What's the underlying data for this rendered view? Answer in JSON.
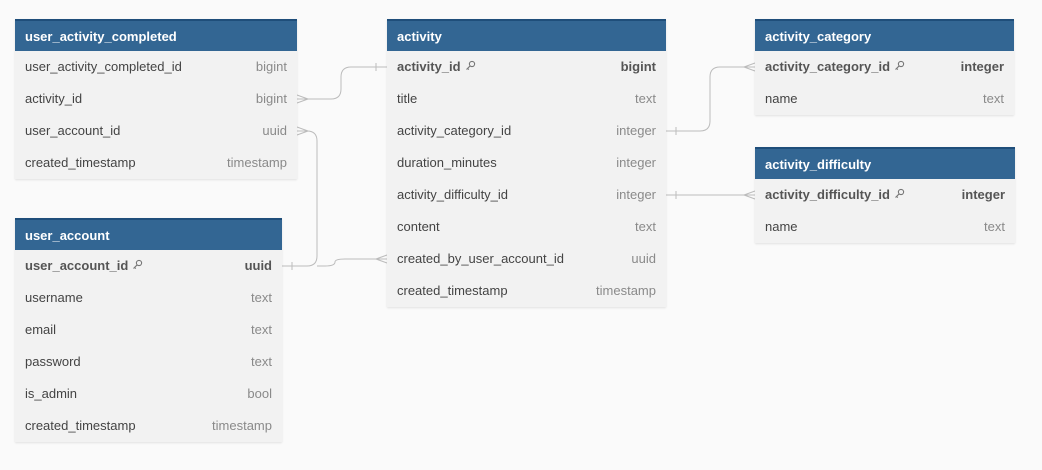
{
  "colors": {
    "header": "#336693",
    "header_border": "#1f4e7a",
    "line": "#bcbcbc"
  },
  "tables": [
    {
      "name": "user_activity_completed",
      "columns": [
        {
          "name": "user_activity_completed_id",
          "type": "bigint",
          "pk": false
        },
        {
          "name": "activity_id",
          "type": "bigint",
          "pk": false
        },
        {
          "name": "user_account_id",
          "type": "uuid",
          "pk": false
        },
        {
          "name": "created_timestamp",
          "type": "timestamp",
          "pk": false
        }
      ]
    },
    {
      "name": "user_account",
      "columns": [
        {
          "name": "user_account_id",
          "type": "uuid",
          "pk": true
        },
        {
          "name": "username",
          "type": "text",
          "pk": false
        },
        {
          "name": "email",
          "type": "text",
          "pk": false
        },
        {
          "name": "password",
          "type": "text",
          "pk": false
        },
        {
          "name": "is_admin",
          "type": "bool",
          "pk": false
        },
        {
          "name": "created_timestamp",
          "type": "timestamp",
          "pk": false
        }
      ]
    },
    {
      "name": "activity",
      "columns": [
        {
          "name": "activity_id",
          "type": "bigint",
          "pk": true
        },
        {
          "name": "title",
          "type": "text",
          "pk": false
        },
        {
          "name": "activity_category_id",
          "type": "integer",
          "pk": false
        },
        {
          "name": "duration_minutes",
          "type": "integer",
          "pk": false
        },
        {
          "name": "activity_difficulty_id",
          "type": "integer",
          "pk": false
        },
        {
          "name": "content",
          "type": "text",
          "pk": false
        },
        {
          "name": "created_by_user_account_id",
          "type": "uuid",
          "pk": false
        },
        {
          "name": "created_timestamp",
          "type": "timestamp",
          "pk": false
        }
      ]
    },
    {
      "name": "activity_category",
      "columns": [
        {
          "name": "activity_category_id",
          "type": "integer",
          "pk": true
        },
        {
          "name": "name",
          "type": "text",
          "pk": false
        }
      ]
    },
    {
      "name": "activity_difficulty",
      "columns": [
        {
          "name": "activity_difficulty_id",
          "type": "integer",
          "pk": true
        },
        {
          "name": "name",
          "type": "text",
          "pk": false
        }
      ]
    }
  ]
}
